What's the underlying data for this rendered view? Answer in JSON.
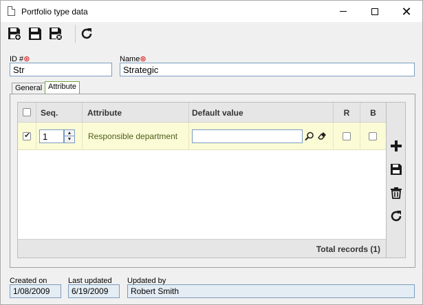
{
  "window": {
    "title": "Portfolio type data",
    "minimize_icon": "minimize-icon",
    "maximize_icon": "maximize-icon",
    "close_icon": "close-icon"
  },
  "toolbar": {
    "buttons": [
      {
        "name": "save-and-new-button",
        "icon": "save-new-icon"
      },
      {
        "name": "save-button",
        "icon": "save-icon"
      },
      {
        "name": "save-and-close-button",
        "icon": "save-close-icon"
      },
      {
        "name": "refresh-button",
        "icon": "refresh-icon"
      }
    ]
  },
  "form": {
    "id_label": "ID #",
    "id_value": "Str",
    "name_label": "Name",
    "name_value": "Strategic"
  },
  "tabs": [
    {
      "label": "General",
      "active": false
    },
    {
      "label": "Attribute",
      "active": true
    }
  ],
  "grid": {
    "columns": {
      "seq": "Seq.",
      "attribute": "Attribute",
      "default_value": "Default value",
      "r": "R",
      "b": "B"
    },
    "rows": [
      {
        "checked": true,
        "seq": "1",
        "attribute": "Responsible department",
        "default_value": "",
        "r": false,
        "b": false
      }
    ],
    "total_records": "Total records (1)"
  },
  "side_actions": [
    {
      "name": "add-button",
      "icon": "plus-icon"
    },
    {
      "name": "save-row-button",
      "icon": "save-icon"
    },
    {
      "name": "delete-button",
      "icon": "trash-icon"
    },
    {
      "name": "refresh-grid-button",
      "icon": "refresh-icon"
    }
  ],
  "footer": {
    "created_label": "Created on",
    "created_value": "1/08/2009",
    "updated_label": "Last updated",
    "updated_value": "6/19/2009",
    "updated_by_label": "Updated by",
    "updated_by_value": "Robert Smith"
  },
  "colors": {
    "row_highlight": "#fbfbd6",
    "attribute_text": "#4d5e1a",
    "required_marker": "#d40000",
    "active_tab_border": "#6fa843"
  }
}
